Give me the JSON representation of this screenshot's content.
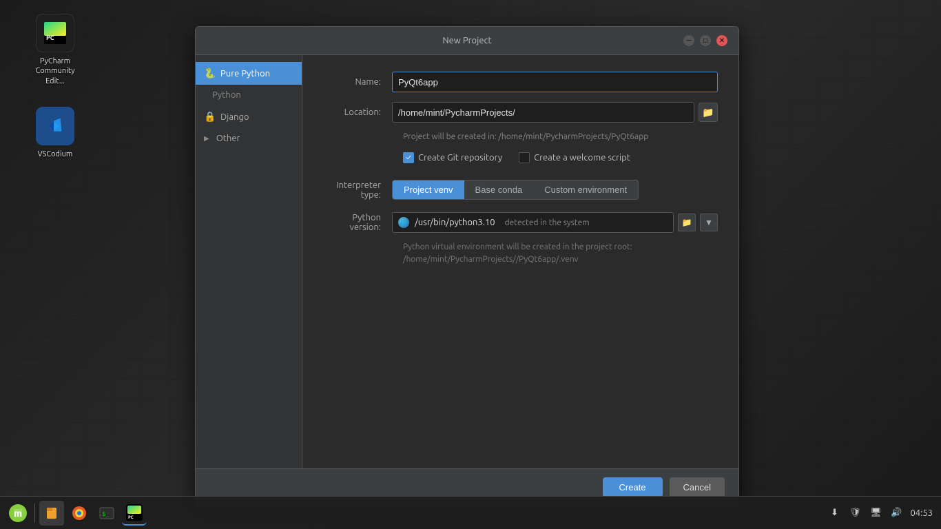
{
  "desktop": {
    "icons": [
      {
        "id": "pycharm",
        "label": "PyCharm\nCommunity Edit...",
        "label_line1": "PyCharm",
        "label_line2": "Community Edit..."
      },
      {
        "id": "vscodium",
        "label": "VSCodium"
      }
    ]
  },
  "dialog": {
    "title": "New Project",
    "sidebar": {
      "items": [
        {
          "id": "pure-python",
          "label": "Pure Python",
          "active": true,
          "icon": "🐍"
        },
        {
          "id": "python",
          "label": "Python",
          "active": false,
          "sub": true
        },
        {
          "id": "django",
          "label": "Django",
          "active": false,
          "icon": "🔒"
        },
        {
          "id": "other",
          "label": "Other",
          "active": false,
          "expand": "▶"
        }
      ]
    },
    "form": {
      "name_label": "Name:",
      "name_value": "PyQt6app",
      "location_label": "Location:",
      "location_value": "/home/mint/PycharmProjects/",
      "project_path_info": "Project will be created in: /home/mint/PycharmProjects/PyQt6app",
      "create_git_label": "Create Git repository",
      "create_welcome_label": "Create a welcome script",
      "interpreter_label": "Interpreter type:",
      "tabs": [
        {
          "id": "project-venv",
          "label": "Project venv",
          "active": true
        },
        {
          "id": "base-conda",
          "label": "Base conda",
          "active": false
        },
        {
          "id": "custom-env",
          "label": "Custom environment",
          "active": false
        }
      ],
      "python_version_label": "Python version:",
      "python_version_value": "/usr/bin/python3.10",
      "python_detected": "detected in the system",
      "venv_info_line1": "Python virtual environment will be created in the project root:",
      "venv_info_line2": "/home/mint/PycharmProjects//PyQt6app/.venv"
    },
    "footer": {
      "create_label": "Create",
      "cancel_label": "Cancel"
    }
  },
  "taskbar": {
    "time": "04:53",
    "apps": [
      {
        "id": "mint",
        "label": "Linux Mint"
      },
      {
        "id": "files",
        "label": "Files"
      },
      {
        "id": "firefox",
        "label": "Firefox"
      },
      {
        "id": "terminal",
        "label": "Terminal"
      },
      {
        "id": "pycharm-task",
        "label": "PyCharm"
      }
    ]
  }
}
